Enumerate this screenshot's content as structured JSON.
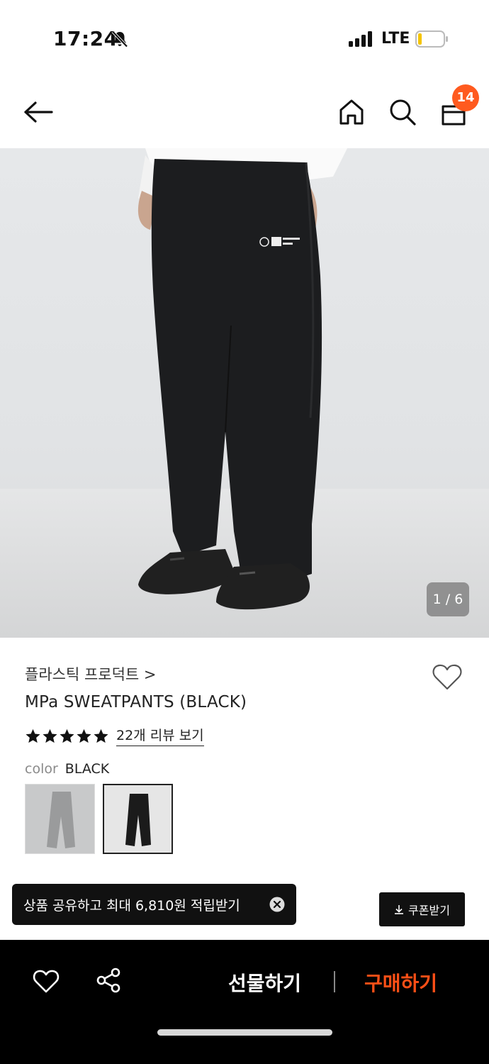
{
  "status": {
    "time": "17:24",
    "network": "LTE"
  },
  "header": {
    "cart_count": "14"
  },
  "gallery": {
    "counter": "1 / 6"
  },
  "product": {
    "brand": "플라스틱 프로덕트 >",
    "name": "MPa SWEATPANTS (BLACK)",
    "rating_stars": 5,
    "review_link": "22개 리뷰 보기",
    "color_label": "color",
    "color_value": "BLACK"
  },
  "promo": {
    "toast": "상품 공유하고 최대 6,810원 적립받기",
    "coupon_button": "쿠폰받기"
  },
  "actions": {
    "gift": "선물하기",
    "buy": "구매하기"
  },
  "colors": {
    "accent": "#ff5a1f",
    "buy": "#ff4f16",
    "dark": "#000000"
  }
}
